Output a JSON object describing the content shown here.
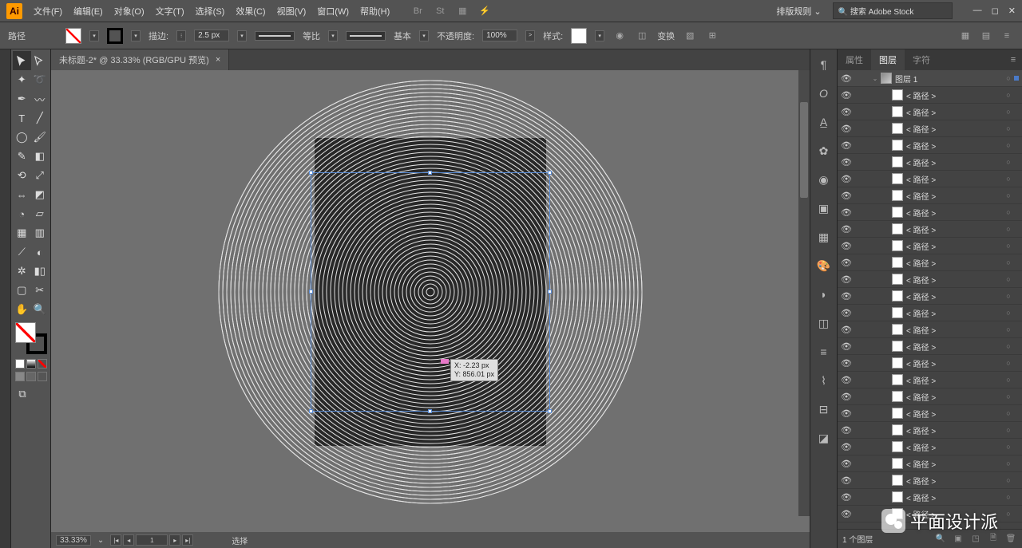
{
  "app": {
    "logo": "Ai"
  },
  "menu": {
    "items": [
      "文件(F)",
      "编辑(E)",
      "对象(O)",
      "文字(T)",
      "选择(S)",
      "效果(C)",
      "视图(V)",
      "窗口(W)",
      "帮助(H)"
    ],
    "workspace": "排版规则",
    "search_placeholder": "搜索 Adobe Stock"
  },
  "options": {
    "tool_label": "路径",
    "stroke_label": "描边:",
    "stroke_weight": "2.5 px",
    "profile_label": "等比",
    "brush_label": "基本",
    "opacity_label": "不透明度:",
    "opacity_value": "100%",
    "style_label": "样式:",
    "transform_label": "变换"
  },
  "doc": {
    "tab_title": "未标题-2* @ 33.33% (RGB/GPU 预览)",
    "measure_x": "X: -2.23 px",
    "measure_y": "Y: 856.01 px"
  },
  "status": {
    "zoom": "33.33%",
    "artboard": "1",
    "tool": "选择"
  },
  "panels": {
    "tabs": [
      "属性",
      "图层",
      "字符"
    ],
    "active": 1,
    "top_layer": "图层 1",
    "path_label": "< 路径 >",
    "path_count": 26,
    "footer": "1 个图层"
  },
  "watermark": "平面设计派"
}
